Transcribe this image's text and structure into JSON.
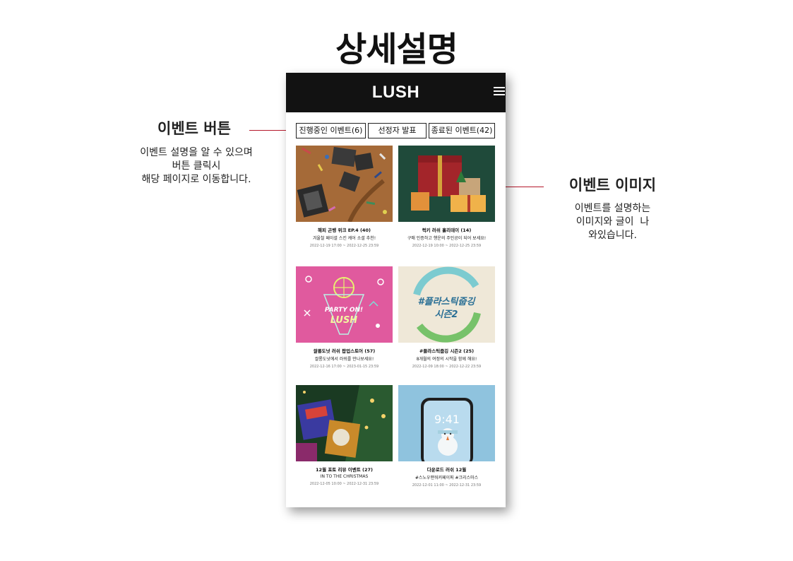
{
  "page_title": "상세설명",
  "left_annotation": {
    "title": "이벤트 버튼",
    "desc_lines": [
      "이벤트 설명을 알 수 있으며",
      "버튼 클릭시",
      "해당 페이지로 이동합니다."
    ]
  },
  "right_annotation": {
    "title": "이벤트 이미지",
    "desc_lines": [
      "이벤트를 설명하는",
      "이미지와 글이  나",
      "와있습니다."
    ]
  },
  "phone": {
    "brand": "LUSH",
    "menu_icon": "hamburger-menu-icon",
    "tabs": [
      {
        "label": "진행중인 이벤트(6)"
      },
      {
        "label": "선정자 발표"
      },
      {
        "label": "종료된 이벤트(42)"
      }
    ],
    "events": [
      {
        "title": "해피 곤벵 위크 EP.4 (40)",
        "subtitle": "겨울철 페이셜 스킨 케어 소셜 추천!",
        "date": "2022-12-19 17:00 ~ 2022-12-25 23:59",
        "image": "brown-pattern-boxes"
      },
      {
        "title": "럭키 러쉬 홀리데이 (14)",
        "subtitle": "구매 인증하고 행운의 주인공이 되어 보세요!",
        "date": "2022-12-19 10:00 ~ 2022-12-25 23:59",
        "image": "gift-boxes-green"
      },
      {
        "title": "쌀롱도넛 러쉬 팝업스토어 (57)",
        "subtitle": "쌀롱도넛에서 러쉬를 만나보세요!",
        "date": "2022-12-16 17:00 ~ 2023-01-15 23:59",
        "image": "party-on-lush-pink"
      },
      {
        "title": "#플라스틱줍깅 시즌2 (25)",
        "subtitle": "8개월의 여정의 시작을 함께 해요!",
        "date": "2022-12-09 18:00 ~ 2022-12-22 23:59",
        "image": "plastic-jogging-season2"
      },
      {
        "title": "12월 포토 리뷰 이벤트 (27)",
        "subtitle": "IN TO THE CHRISTMAS",
        "date": "2022-12-05 10:00 ~ 2022-12-31 23:59",
        "image": "christmas-gifts-tree"
      },
      {
        "title": "다운로드 러쉬 12월",
        "subtitle": "#스노우맨워커페이퍼 #크리스마스",
        "date": "2022-12-01 11:00 ~ 2022-12-31 23:59",
        "image": "phone-lockscreen-snowman"
      }
    ],
    "lockscreen_time": "9:41",
    "poster_text": {
      "party": [
        "PARTY ON!",
        "LUSH"
      ],
      "plastic": [
        "#플라스틱줍깅",
        "시즌2"
      ]
    }
  },
  "colors": {
    "header_bg": "#121212",
    "annotation_line": "#b5172a"
  }
}
